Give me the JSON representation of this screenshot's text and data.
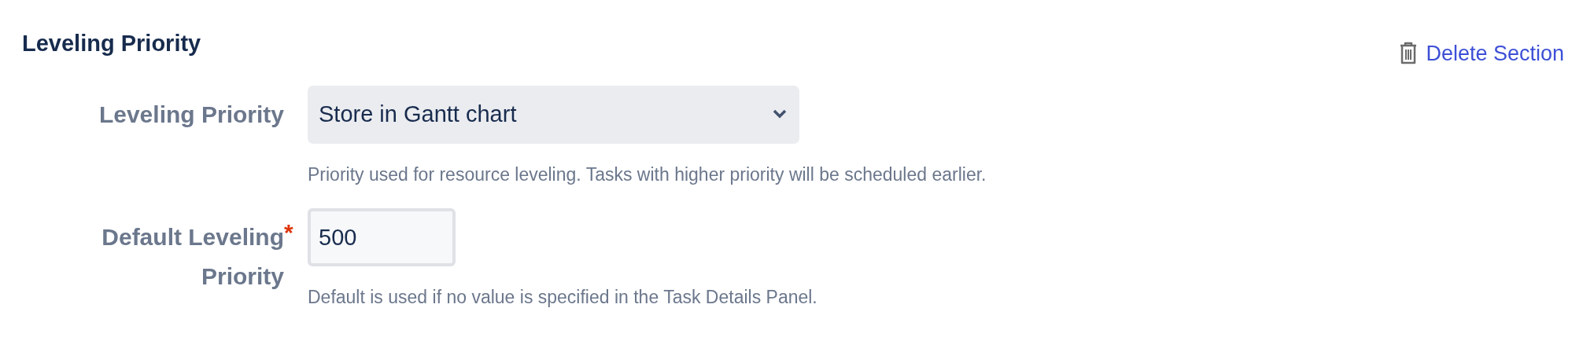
{
  "section": {
    "title": "Leveling Priority",
    "delete_action": "Delete Section"
  },
  "fields": [
    {
      "kind": "select",
      "label_lines": [
        "Leveling Priority"
      ],
      "value": "Store in Gantt chart",
      "help": "Priority used for resource leveling. Tasks with higher priority will be scheduled earlier."
    },
    {
      "kind": "text",
      "label_lines": [
        "Default Leveling",
        "Priority"
      ],
      "required_mark": "*",
      "value": "500",
      "help": "Default is used if no value is specified in the Task Details Panel."
    }
  ]
}
